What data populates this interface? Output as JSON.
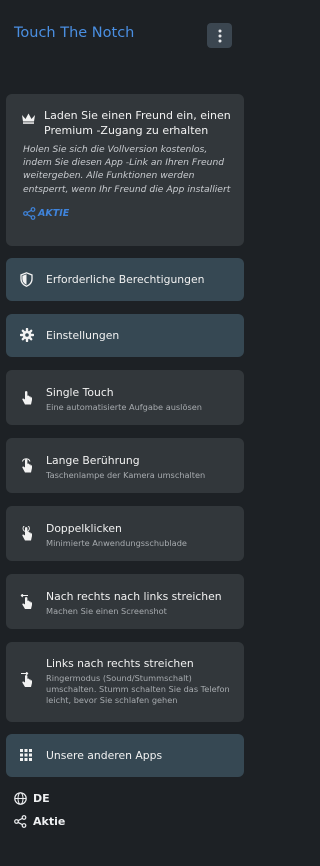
{
  "header": {
    "title": "Touch The Notch",
    "menu_icon": "more-vert-icon"
  },
  "promo": {
    "title": "Laden Sie einen Freund ein, einen Premium -Zugang zu erhalten",
    "body": "Holen Sie sich die Vollversion kostenlos, indem Sie diesen App -Link an Ihren Freund weitergeben. Alle Funktionen werden entsperrt, wenn Ihr Freund die App installiert",
    "share_label": "AKTIE",
    "icon": "crown-icon"
  },
  "menu": {
    "permissions": {
      "label": "Erforderliche Berechtigungen",
      "icon": "shield-icon"
    },
    "settings": {
      "label": "Einstellungen",
      "icon": "gear-icon"
    },
    "gestures": [
      {
        "title": "Single Touch",
        "subtitle": "Eine automatisierte Aufgabe auslösen",
        "icon": "tap-icon"
      },
      {
        "title": "Lange Berührung",
        "subtitle": "Taschenlampe der Kamera umschalten",
        "icon": "long-press-icon"
      },
      {
        "title": "Doppelklicken",
        "subtitle": "Minimierte Anwendungsschublade",
        "icon": "double-tap-icon"
      },
      {
        "title": "Nach rechts nach links streichen",
        "subtitle": "Machen Sie einen Screenshot",
        "icon": "swipe-left-icon"
      },
      {
        "title": "Links nach rechts streichen",
        "subtitle": "Ringermodus (Sound/Stummschalt) umschalten. Stumm schalten Sie das Telefon leicht, bevor Sie schlafen gehen",
        "icon": "swipe-right-icon"
      }
    ],
    "other_apps": {
      "label": "Unsere anderen Apps",
      "icon": "apps-grid-icon"
    }
  },
  "footer": {
    "language": {
      "label": "DE",
      "icon": "globe-icon"
    },
    "share": {
      "label": "Aktie",
      "icon": "share-icon"
    }
  },
  "colors": {
    "background": "#1d2125",
    "card": "#32373b",
    "card_accent": "#364853",
    "title_accent": "#4a8fe2"
  }
}
